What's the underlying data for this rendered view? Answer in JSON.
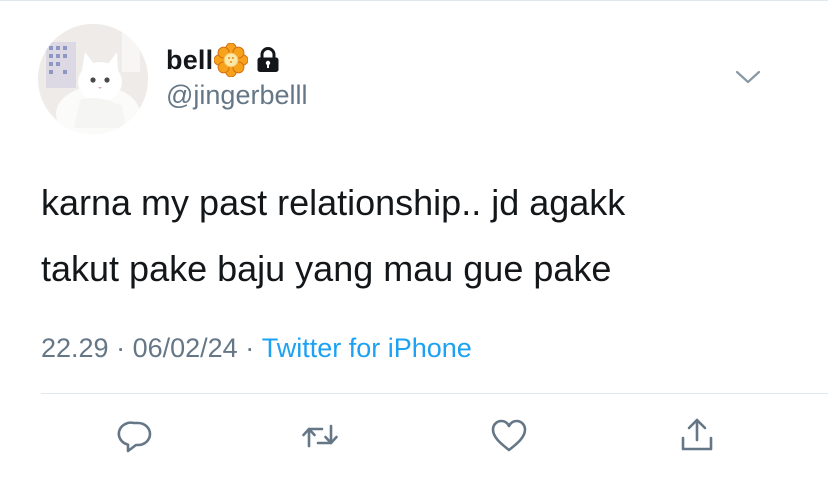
{
  "tweet": {
    "author": {
      "display_name": "bell",
      "handle": "@jingerbelll",
      "name_emoji": "blossom-flower-icon",
      "protected_icon": "lock-icon"
    },
    "text": "karna my past relationship.. jd agakk\ntakut pake baju yang mau gue pake",
    "meta": {
      "time": "22.29",
      "separator": " · ",
      "date": "06/02/24",
      "source": "Twitter for iPhone"
    },
    "actions": [
      "reply-icon",
      "retweet-icon",
      "like-icon",
      "share-icon"
    ],
    "menu_icon": "chevron-down-icon"
  },
  "colors": {
    "text": "#14171a",
    "secondary": "#657786",
    "link": "#1da1f2",
    "divider": "#e1e8ed"
  }
}
